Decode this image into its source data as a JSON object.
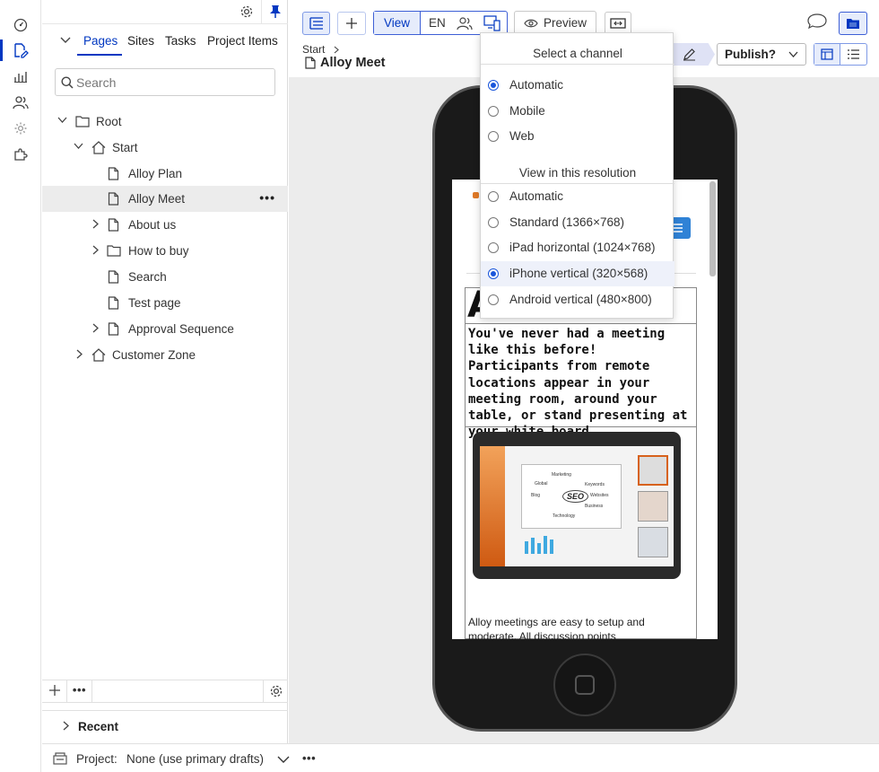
{
  "nav": {
    "tabs": [
      "Pages",
      "Sites",
      "Tasks",
      "Project Items"
    ],
    "search_placeholder": "Search",
    "tree": [
      {
        "label": "Root"
      },
      {
        "label": "Start"
      },
      {
        "label": "Alloy Plan"
      },
      {
        "label": "Alloy Meet"
      },
      {
        "label": "About us"
      },
      {
        "label": "How to buy"
      },
      {
        "label": "Search"
      },
      {
        "label": "Test page"
      },
      {
        "label": "Approval Sequence"
      },
      {
        "label": "Customer Zone"
      }
    ],
    "recent_label": "Recent"
  },
  "project": {
    "label": "Project:",
    "value": "None (use primary drafts)"
  },
  "toolbar": {
    "view_label": "View",
    "language": "EN",
    "preview_label": "Preview",
    "publish_label": "Publish?",
    "breadcrumb": "Start",
    "page_title": "Alloy Meet"
  },
  "channel_dropdown": {
    "channel_heading": "Select a channel",
    "channels": [
      {
        "label": "Automatic",
        "selected": true
      },
      {
        "label": "Mobile",
        "selected": false
      },
      {
        "label": "Web",
        "selected": false
      }
    ],
    "resolution_heading": "View in this resolution",
    "resolutions": [
      {
        "label": "Automatic",
        "selected": false
      },
      {
        "label": "Standard (1366×768)",
        "selected": false
      },
      {
        "label": "iPad horizontal (1024×768)",
        "selected": false
      },
      {
        "label": "iPhone vertical (320×568)",
        "selected": true
      },
      {
        "label": "Android vertical (480×800)",
        "selected": false
      }
    ]
  },
  "preview_content": {
    "heading_fragment": "A",
    "intro": "You've never had a meeting like this before! Participants from remote locations appear in your meeting room, around your table, or stand presenting at your white board.",
    "seo_words": [
      "Marketing",
      "Global",
      "Keywords",
      "Blog",
      "SEO",
      "Websites",
      "Business",
      "Technology"
    ],
    "body_text": "Alloy meetings are easy to setup and moderate. All discussion points"
  },
  "colors": {
    "accent": "#0037c1",
    "selection": "#1a56db"
  }
}
